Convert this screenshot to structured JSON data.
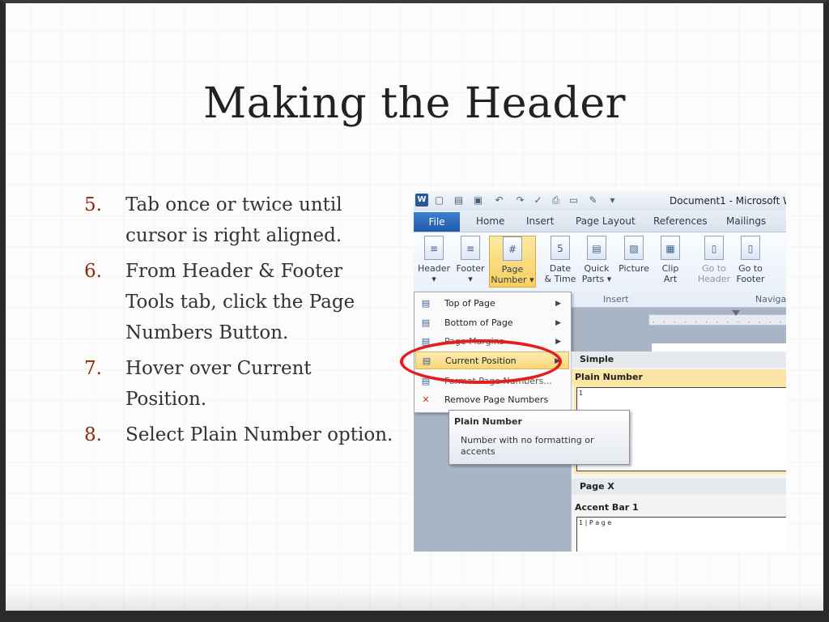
{
  "slide": {
    "title": "Making the Header",
    "steps": [
      {
        "number": "5.",
        "text": "Tab once or twice until cursor is right aligned."
      },
      {
        "number": "6.",
        "text": "From Header & Footer Tools tab, click the Page Numbers Button."
      },
      {
        "number": "7.",
        "text": "Hover over Current Position."
      },
      {
        "number": "8.",
        "text": "Select Plain Number option."
      }
    ],
    "accent_color": "#8b2c0f",
    "highlight_circle_color": "#e41d1d"
  },
  "word": {
    "app_icon": "W",
    "window_title": "Document1 - Microsoft W",
    "quick_access_icons": [
      "save-icon",
      "undo-icon",
      "redo-icon",
      "spelling-icon",
      "print-preview-icon",
      "quick-print-icon",
      "format-painter-icon",
      "customize-icon"
    ],
    "tabs": {
      "file": "File",
      "home": "Home",
      "insert": "Insert",
      "page_layout": "Page Layout",
      "references": "References",
      "mailings": "Mailings"
    },
    "ribbon": {
      "header": "Header",
      "footer": "Footer",
      "page_number_line1": "Page",
      "page_number_line2": "Number",
      "date_time_line1": "Date",
      "date_time_line2": "& Time",
      "quick_parts_line1": "Quick",
      "quick_parts_line2": "Parts",
      "picture": "Picture",
      "clip_art_line1": "Clip",
      "clip_art_line2": "Art",
      "goto_header_line1": "Go to",
      "goto_header_line2": "Header",
      "goto_footer_line1": "Go to",
      "goto_footer_line2": "Footer",
      "group_insert": "Insert",
      "group_navigation": "Navigat"
    },
    "ruler_ticks": ". . . . . . . . . . . . .",
    "page_number_menu": {
      "items": [
        {
          "label": "Top of Page",
          "icon": "top-of-page-icon",
          "submenu": true
        },
        {
          "label": "Bottom of Page",
          "icon": "bottom-of-page-icon",
          "submenu": true
        },
        {
          "label": "Page Margins",
          "icon": "page-margins-icon",
          "submenu": true
        },
        {
          "label": "Current Position",
          "icon": "current-position-icon",
          "submenu": true,
          "highlighted": true
        },
        {
          "label": "Format Page Numbers...",
          "icon": "format-page-numbers-icon",
          "submenu": false
        },
        {
          "label": "Remove Page Numbers",
          "icon": "remove-page-numbers-icon",
          "submenu": false
        }
      ]
    },
    "current_position_gallery": {
      "section_simple": "Simple",
      "plain_number": "Plain Number",
      "plain_number_preview": "1",
      "section_page_x": "Page X",
      "accent_bar": "Accent Bar 1",
      "accent_bar_preview": "1 | P a g e"
    },
    "tooltip": {
      "title": "Plain Number",
      "body": "Number with no formatting or accents"
    }
  }
}
